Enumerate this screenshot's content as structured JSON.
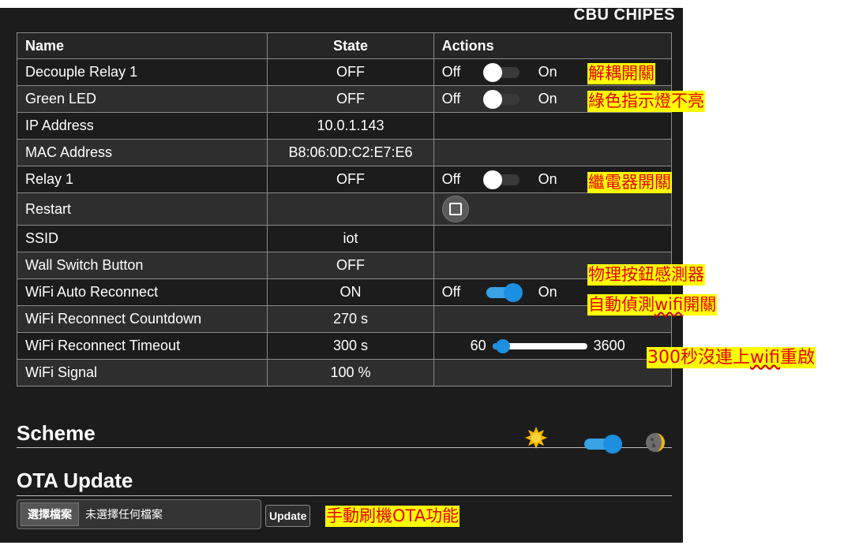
{
  "brand": "CBU CHIPES",
  "table": {
    "headers": {
      "name": "Name",
      "state": "State",
      "actions": "Actions"
    },
    "rows": [
      {
        "name": "Decouple Relay 1",
        "state": "OFF",
        "off": "Off",
        "on": "On"
      },
      {
        "name": "Green LED",
        "state": "OFF",
        "off": "Off",
        "on": "On"
      },
      {
        "name": "IP Address",
        "state": "10.0.1.143"
      },
      {
        "name": "MAC Address",
        "state": "B8:06:0D:C2:E7:E6"
      },
      {
        "name": "Relay 1",
        "state": "OFF",
        "off": "Off",
        "on": "On"
      },
      {
        "name": "Restart",
        "state": ""
      },
      {
        "name": "SSID",
        "state": "iot"
      },
      {
        "name": "Wall Switch Button",
        "state": "OFF"
      },
      {
        "name": "WiFi Auto Reconnect",
        "state": "ON",
        "off": "Off",
        "on": "On"
      },
      {
        "name": "WiFi Reconnect Countdown",
        "state": "270 s"
      },
      {
        "name": "WiFi Reconnect Timeout",
        "state": "300 s",
        "slider_min": "60",
        "slider_max": "3600",
        "slider_value": 300
      },
      {
        "name": "WiFi Signal",
        "state": "100 %"
      }
    ]
  },
  "toggles": {
    "decouple_relay": false,
    "green_led": false,
    "relay_1": false,
    "wifi_auto_reconnect": true,
    "scheme_dark": true
  },
  "scheme": {
    "title": "Scheme"
  },
  "ota": {
    "title": "OTA Update",
    "choose_file": "選擇檔案",
    "no_file": "未選擇任何檔案",
    "update": "Update"
  },
  "annotations": {
    "decouple": "解耦開關",
    "green_led": "綠色指示燈不亮",
    "relay": "繼電器開關",
    "wall_switch": "物理按鈕感測器",
    "auto_reconnect_pre": "自動偵測",
    "auto_reconnect_wifi": "wifi",
    "auto_reconnect_post": "開關",
    "timeout_pre": "300秒沒連上",
    "timeout_wifi": "wifi",
    "timeout_post": "重啟",
    "ota": "手動刷機OTA功能"
  },
  "colors": {
    "panel_bg": "#1c1c1c",
    "accent": "#1c8fe0",
    "annotation_bg": "#ffff00",
    "annotation_text": "#e60000"
  }
}
